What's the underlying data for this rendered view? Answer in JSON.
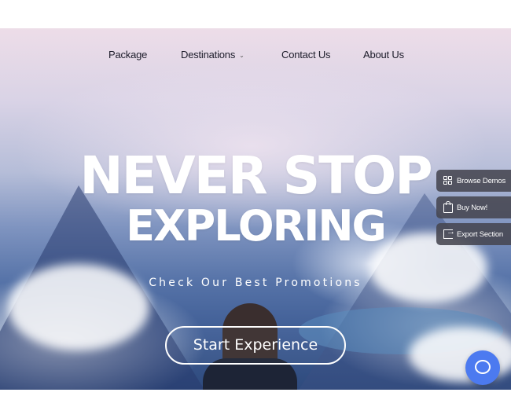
{
  "nav": {
    "items": [
      {
        "label": "Package"
      },
      {
        "label": "Destinations",
        "has_dropdown": true
      },
      {
        "label": "Contact Us"
      },
      {
        "label": "About Us"
      }
    ],
    "dropdown_icon": "chevron-down-icon"
  },
  "hero": {
    "headline_line1": "NEVER STOP",
    "headline_line2": "EXPLORING",
    "subtitle": "Check Our Best Promotions",
    "cta_label": "Start Experience"
  },
  "side_panel": {
    "buttons": [
      {
        "label": "Browse Demos",
        "icon": "grid-icon"
      },
      {
        "label": "Buy Now!",
        "icon": "shopping-bag-icon"
      },
      {
        "label": "Export Section",
        "icon": "export-icon"
      }
    ]
  },
  "chat": {
    "icon": "chat-bubble-icon",
    "color": "#4c7af0"
  },
  "colors": {
    "text_dark": "#1c1c2a",
    "hero_text": "#ffffff",
    "side_button_bg": "#46464f"
  }
}
